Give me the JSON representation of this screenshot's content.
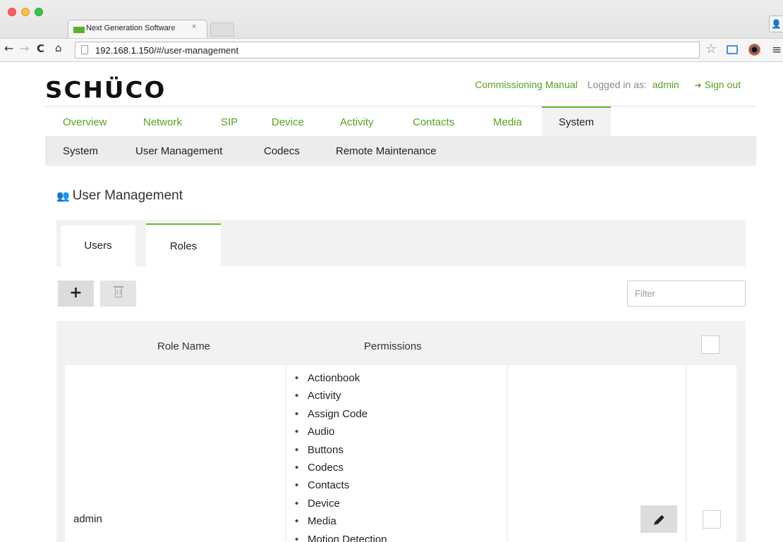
{
  "browser": {
    "tab_title": "Next Generation Software",
    "tab_close": "×",
    "url_host": "192.168.1.150",
    "url_path": "/#/user-management"
  },
  "header": {
    "logo": "SCHÜCO",
    "commissioning_manual": "Commissioning Manual",
    "logged_in_label": "Logged in as:",
    "username": "admin",
    "sign_out": "Sign out"
  },
  "main_nav": {
    "items": [
      {
        "label": "Overview"
      },
      {
        "label": "Network"
      },
      {
        "label": "SIP"
      },
      {
        "label": "Device"
      },
      {
        "label": "Activity"
      },
      {
        "label": "Contacts"
      },
      {
        "label": "Media"
      },
      {
        "label": "System",
        "active": true
      }
    ]
  },
  "sub_nav": {
    "items": [
      {
        "label": "System"
      },
      {
        "label": "User Management",
        "active": true
      },
      {
        "label": "Codecs"
      },
      {
        "label": "Remote Maintenance"
      }
    ]
  },
  "page": {
    "title": "User Management",
    "tabs": [
      {
        "label": "Users"
      },
      {
        "label": "Roles",
        "active": true
      }
    ],
    "add_icon": "+",
    "filter_placeholder": "Filter",
    "filter_value": ""
  },
  "table": {
    "headers": {
      "role_name": "Role Name",
      "permissions": "Permissions"
    },
    "rows": [
      {
        "role_name": "admin",
        "permissions": [
          "Actionbook",
          "Activity",
          "Assign Code",
          "Audio",
          "Buttons",
          "Codecs",
          "Contacts",
          "Device",
          "Media",
          "Motion Detection"
        ]
      }
    ]
  },
  "colors": {
    "accent": "#5aa11f",
    "active_border": "#6ab72f"
  }
}
